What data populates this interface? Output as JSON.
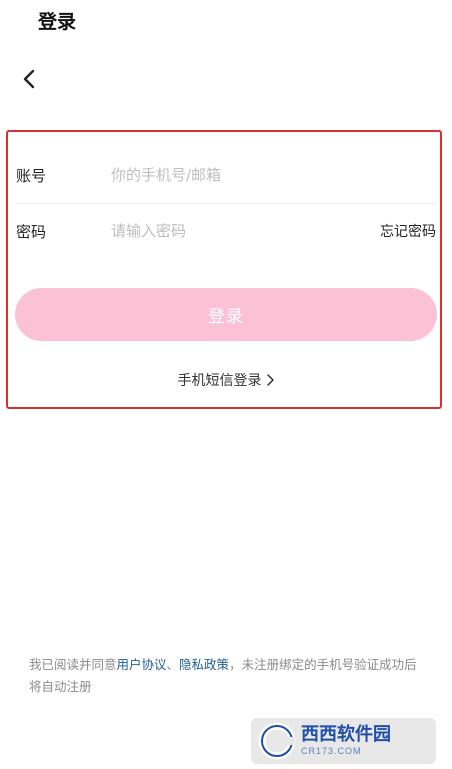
{
  "header": {
    "title": "登录"
  },
  "form": {
    "account_label": "账号",
    "account_placeholder": "你的手机号/邮箱",
    "account_value": "",
    "password_label": "密码",
    "password_placeholder": "请输入密码",
    "password_value": "",
    "forgot_password": "忘记密码",
    "login_button": "登录",
    "sms_login": "手机短信登录"
  },
  "agreement": {
    "prefix": "我已阅读并同意",
    "user_agreement": "用户协议",
    "separator": "、",
    "privacy_policy": "隐私政策",
    "suffix": "，未注册绑定的手机号验证成功后将自动注册"
  },
  "watermark": {
    "main": "西西软件园",
    "sub": "CR173.COM"
  },
  "colors": {
    "login_button": "#fbc2d6",
    "highlight_border": "#d8322f",
    "link": "#1f5f8f",
    "placeholder": "#bdbdbd"
  }
}
